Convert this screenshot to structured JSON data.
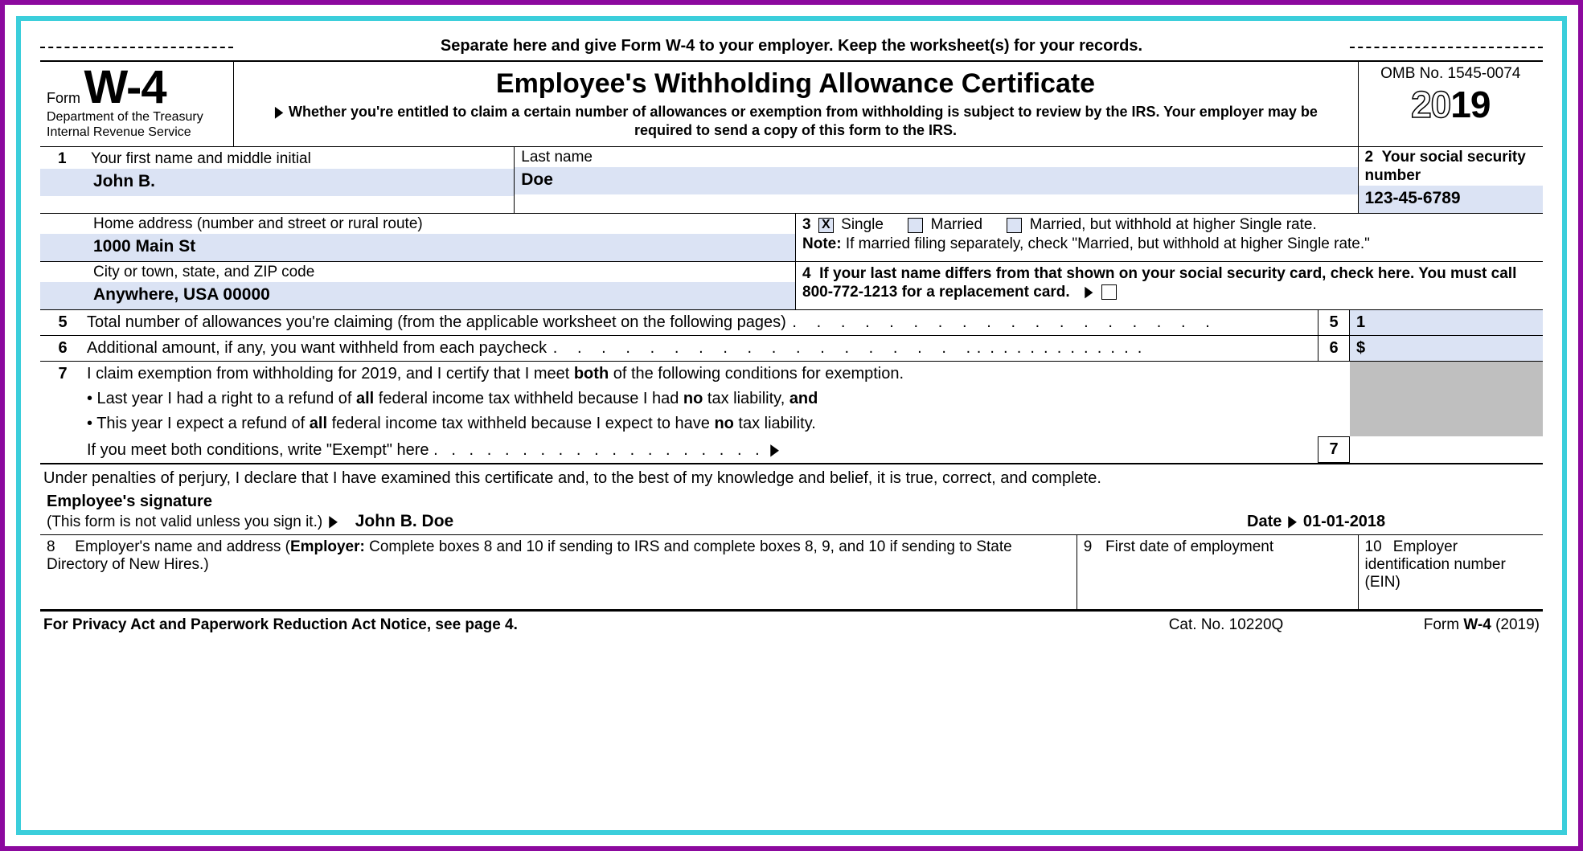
{
  "separator_text": "Separate here and give Form W-4 to your employer. Keep the worksheet(s) for your records.",
  "header": {
    "form_word": "Form",
    "form_code": "W-4",
    "dept1": "Department of the Treasury",
    "dept2": "Internal Revenue Service",
    "title": "Employee's Withholding Allowance Certificate",
    "subtitle": "Whether you're entitled to claim a certain number of allowances or exemption from withholding is subject to review by the IRS. Your employer may be required to send a copy of this form to the IRS.",
    "omb": "OMB No. 1545-0074",
    "year_outline": "20",
    "year_solid": "19"
  },
  "box1": {
    "num": "1",
    "first_label": "Your first name and middle initial",
    "first_value": "John B.",
    "last_label": "Last name",
    "last_value": "Doe"
  },
  "box2": {
    "num": "2",
    "label": "Your social security number",
    "value": "123-45-6789"
  },
  "address": {
    "home_label": "Home address (number and street or rural route)",
    "home_value": "1000 Main St",
    "city_label": "City or town, state, and ZIP code",
    "city_value": "Anywhere, USA 00000"
  },
  "box3": {
    "num": "3",
    "single_checked": "X",
    "opt_single": "Single",
    "opt_married": "Married",
    "opt_married_higher": "Married, but withhold at higher Single rate.",
    "note_label": "Note:",
    "note_text": " If married filing separately, check \"Married, but withhold at higher Single rate.\""
  },
  "box4": {
    "num": "4",
    "text": "If your last name differs from that shown on your social security card, check here. You must call 800-772-1213 for a replacement card."
  },
  "line5": {
    "num": "5",
    "text": "Total number of allowances you're claiming (from the applicable worksheet on the following pages)",
    "box": "5",
    "value": "1"
  },
  "line6": {
    "num": "6",
    "text": "Additional amount, if any, you want withheld from each paycheck",
    "box": "6",
    "value": "$"
  },
  "line7": {
    "num": "7",
    "lead": "I claim exemption from withholding for 2019, and I certify that I meet ",
    "both": "both",
    "lead2": " of the following conditions for exemption.",
    "b1a": "• Last year I had a right to a refund of ",
    "b1_all": "all",
    "b1b": " federal income tax withheld because I had ",
    "b1_no": "no",
    "b1c": " tax liability, ",
    "b1_and": "and",
    "b2a": "• This year I expect a refund of ",
    "b2_all": "all",
    "b2b": " federal income tax withheld because I expect to have ",
    "b2_no": "no",
    "b2c": " tax liability.",
    "tail": "If you meet both conditions, write \"Exempt\" here",
    "box": "7"
  },
  "perjury": "Under penalties of perjury, I declare that I have examined this certificate and, to the best of my knowledge and belief, it is true, correct, and complete.",
  "signature": {
    "label": "Employee's signature",
    "note": "(This form is not valid unless you sign it.)",
    "value": "John B. Doe",
    "date_label": "Date",
    "date_value": "01-01-2018"
  },
  "box8": {
    "num": "8",
    "text_a": "Employer's name and address (",
    "text_b": "Employer:",
    "text_c": " Complete boxes 8 and 10 if sending to IRS and complete boxes 8, 9, and 10 if sending to State Directory of New Hires.)"
  },
  "box9": {
    "num": "9",
    "text": "First date of employment"
  },
  "box10": {
    "num": "10",
    "text": "Employer identification number (EIN)"
  },
  "footer": {
    "left": "For Privacy Act and Paperwork Reduction Act Notice, see page 4.",
    "mid": "Cat. No. 10220Q",
    "right_a": "Form ",
    "right_b": "W-4",
    "right_c": " (2019)"
  }
}
